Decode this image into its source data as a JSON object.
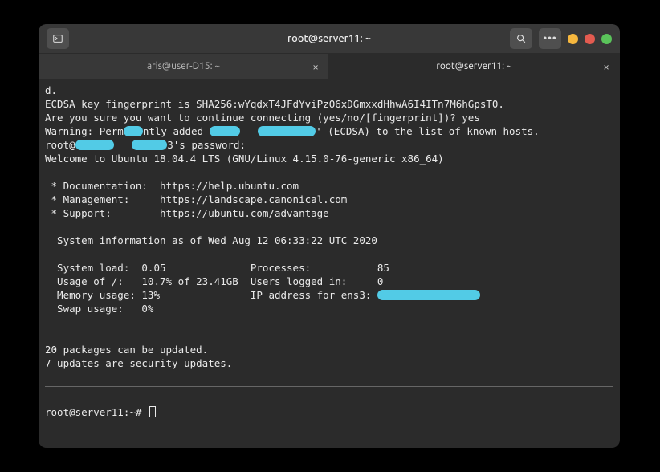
{
  "titlebar": {
    "title": "root@server11: ~"
  },
  "tabs": [
    {
      "label": "aris@user-D15: ~",
      "active": false
    },
    {
      "label": "root@server11: ~",
      "active": true
    }
  ],
  "terminal": {
    "lines": {
      "l0": "d.",
      "l1": "ECDSA key fingerprint is SHA256:wYqdxT4JFdYviPzO6xDGmxxdHhwA6I4ITn7M6hGpsT0.",
      "l2": "Are you sure you want to continue connecting (yes/no/[fingerprint])? yes",
      "l3a": "Warning: Perm",
      "l3b": "ntly added ",
      "l3c": "' (ECDSA) to the list of known hosts.",
      "l4a": "root@",
      "l4b": "3's password:",
      "l5": "Welcome to Ubuntu 18.04.4 LTS (GNU/Linux 4.15.0-76-generic x86_64)",
      "doc": " * Documentation:  https://help.ubuntu.com",
      "mgmt": " * Management:     https://landscape.canonical.com",
      "sup": " * Support:        https://ubuntu.com/advantage",
      "sysinfo_hdr": "  System information as of Wed Aug 12 06:33:22 UTC 2020",
      "s1": "  System load:  0.05              Processes:           85",
      "s2": "  Usage of /:   10.7% of 23.41GB  Users logged in:     0",
      "s3a": "  Memory usage: 13%               IP address for ens3: ",
      "s4": "  Swap usage:   0%",
      "pkg1": "20 packages can be updated.",
      "pkg2": "7 updates are security updates.",
      "prompt": "root@server11:~# "
    }
  }
}
